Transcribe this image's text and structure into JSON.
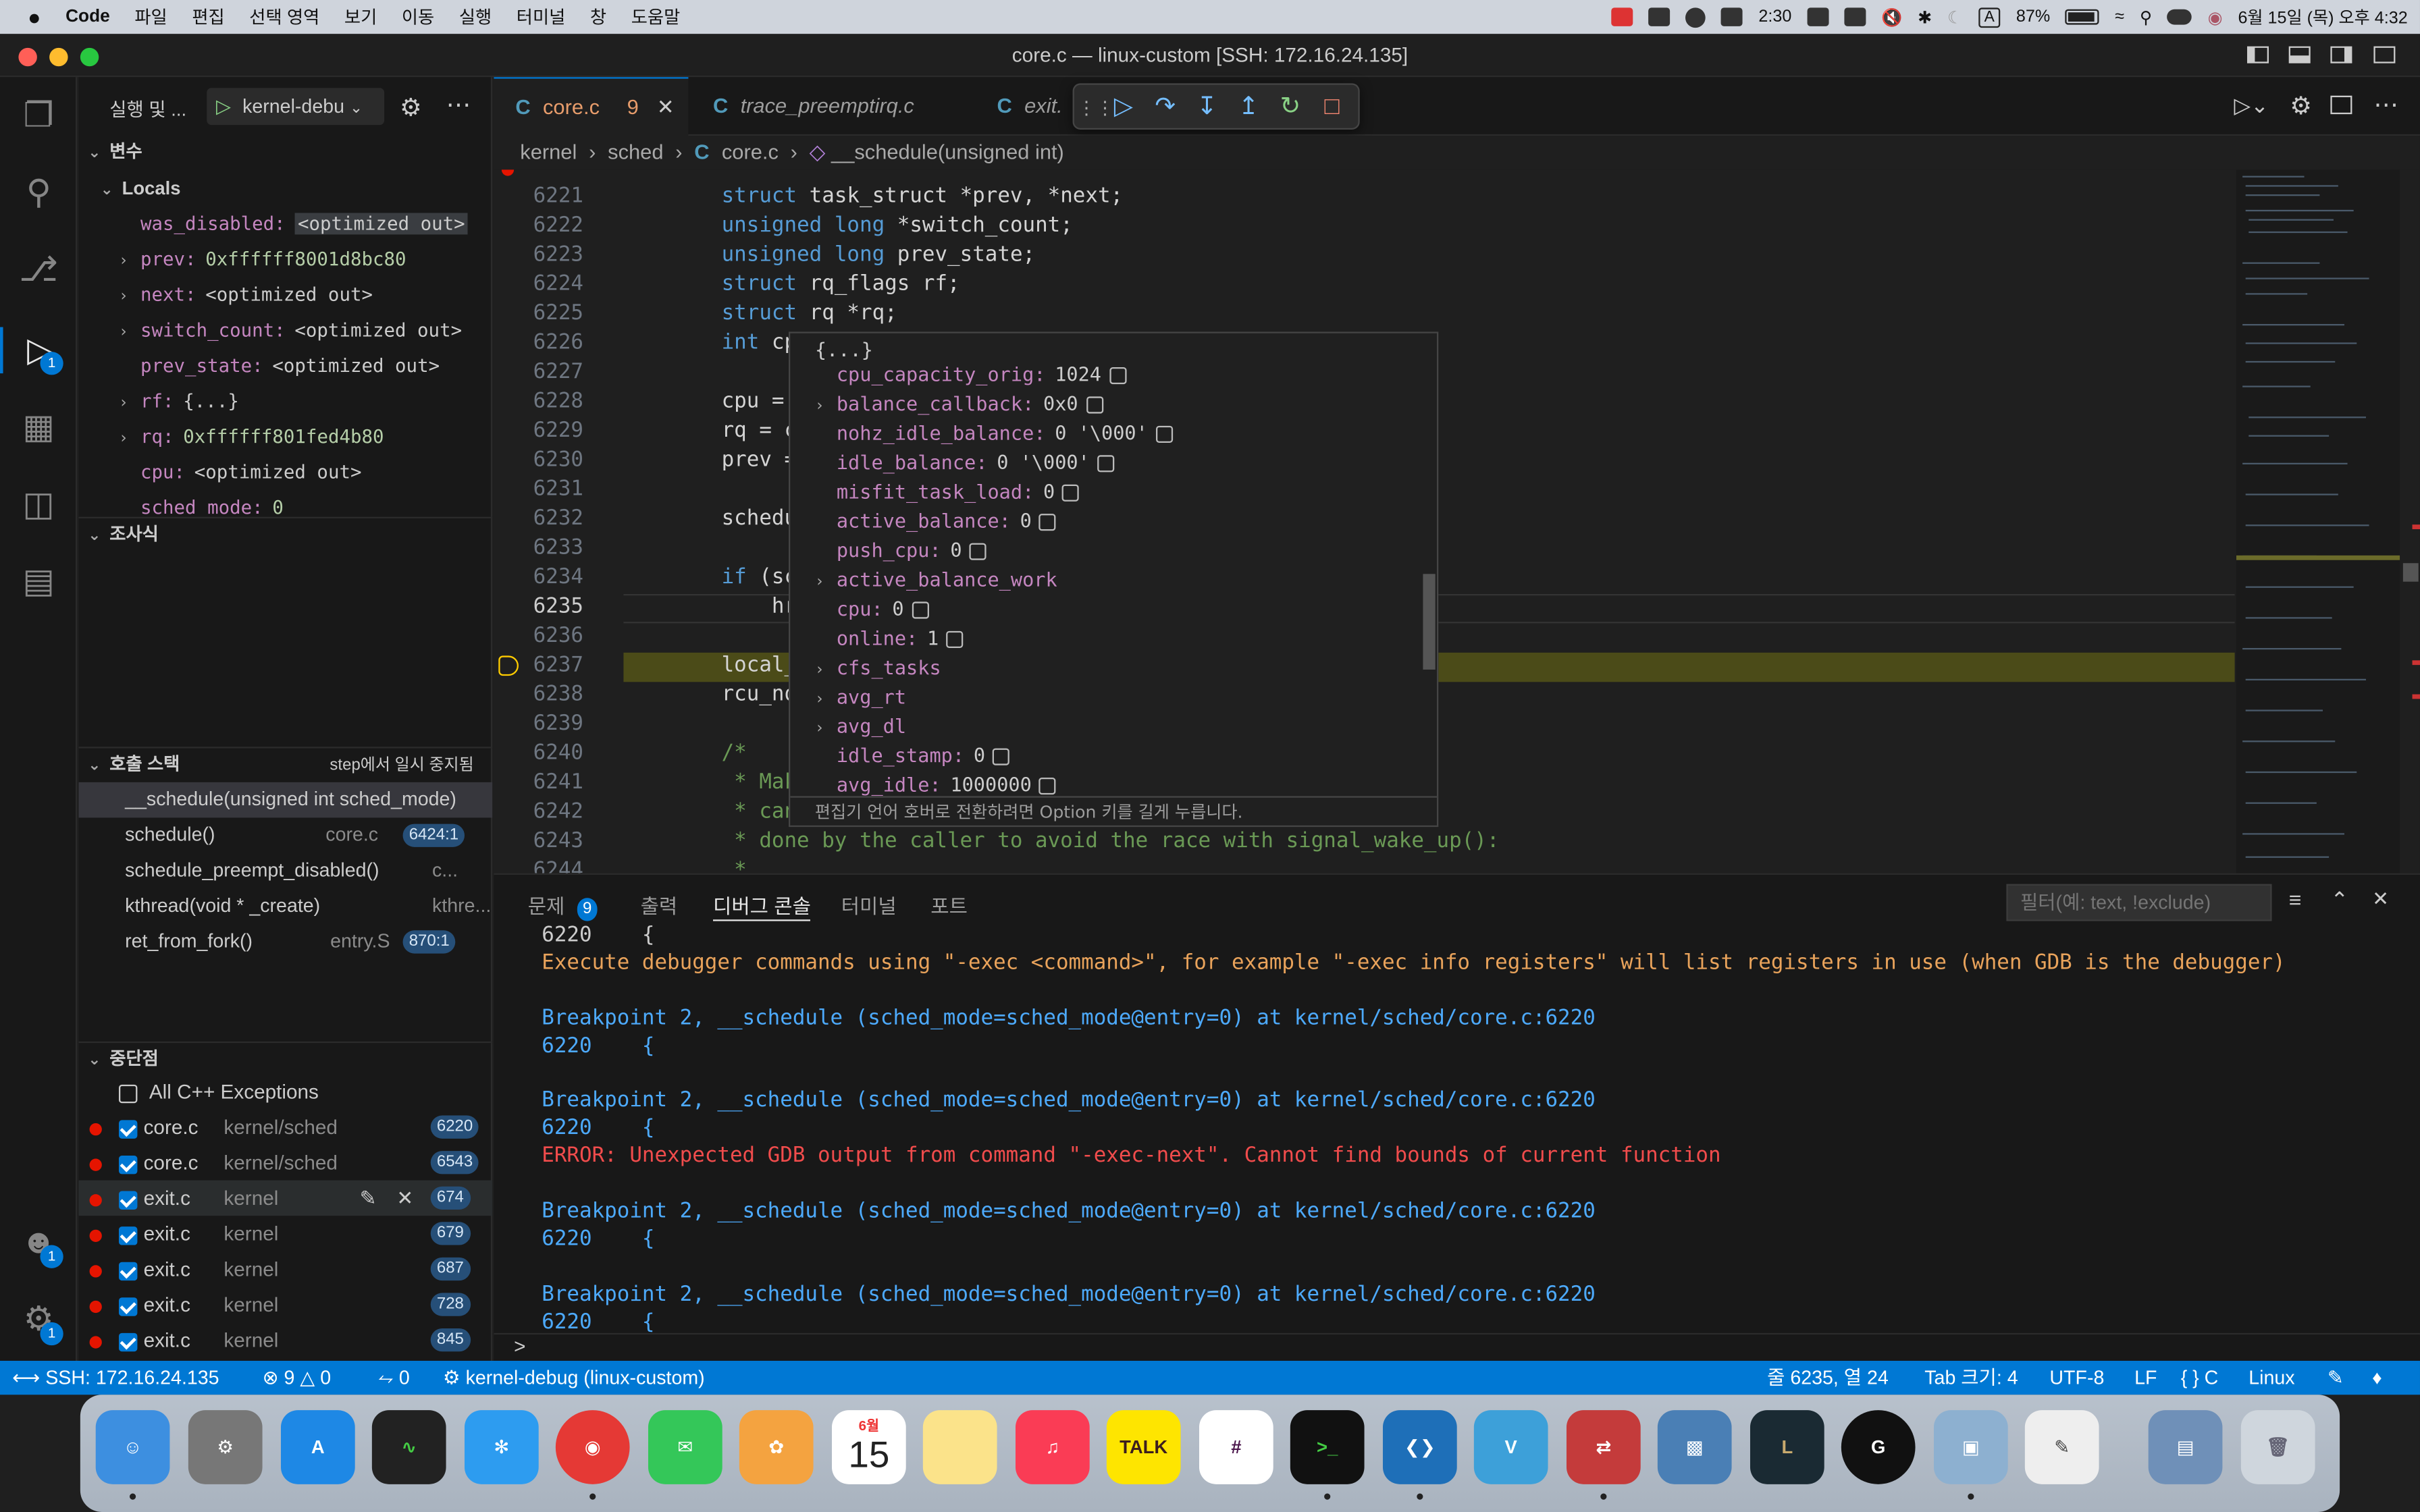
{
  "menubar": {
    "apple": "",
    "app": "Code",
    "items": [
      "파일",
      "편집",
      "선택 영역",
      "보기",
      "이동",
      "실행",
      "터미널",
      "창",
      "도움말"
    ],
    "time": "2:30",
    "battery": "87%",
    "datetime": "6월 15일 (목) 오후 4:32",
    "input_mode": "A"
  },
  "window": {
    "title": "core.c — linux-custom [SSH: 172.16.24.135]"
  },
  "activity": {
    "run_badge": "1",
    "account_badge": "1",
    "settings_badge": "1"
  },
  "sidebar": {
    "run_title": "실행 및 ...",
    "config": "kernel-debu",
    "variables_title": "변수",
    "locals_title": "Locals",
    "locals": [
      {
        "name": "was_disabled:",
        "value": "<optimized out>",
        "expandable": false
      },
      {
        "name": "prev:",
        "value": "0xffffff8001d8bc80",
        "expandable": true
      },
      {
        "name": "next:",
        "value": "<optimized out>",
        "expandable": true
      },
      {
        "name": "switch_count:",
        "value": "<optimized out>",
        "expandable": true
      },
      {
        "name": "prev_state:",
        "value": "<optimized out>",
        "expandable": false
      },
      {
        "name": "rf:",
        "value": "{...}",
        "expandable": true
      },
      {
        "name": "rq:",
        "value": "0xffffff801fed4b80",
        "expandable": true
      },
      {
        "name": "cpu:",
        "value": "<optimized out>",
        "expandable": false
      },
      {
        "name": "sched_mode:",
        "value": "0",
        "expandable": false
      }
    ],
    "watch_title": "조사식",
    "callstack_title": "호출 스택",
    "callstack_status": "step에서 일시 중지됨",
    "callstack": [
      {
        "fn": "__schedule(unsigned int sched_mode)",
        "file": "",
        "line": ""
      },
      {
        "fn": "schedule()",
        "file": "core.c",
        "line": "6424:1"
      },
      {
        "fn": "schedule_preempt_disabled()",
        "file": "c...",
        "line": ""
      },
      {
        "fn": "kthread(void * _create)",
        "file": "kthre...",
        "line": ""
      },
      {
        "fn": "ret_from_fork()",
        "file": "entry.S",
        "line": "870:1"
      }
    ],
    "breakpoints_title": "중단점",
    "all_exceptions": "All C++ Exceptions",
    "breakpoints": [
      {
        "file": "core.c",
        "path": "kernel/sched",
        "line": "6220"
      },
      {
        "file": "core.c",
        "path": "kernel/sched",
        "line": "6543"
      },
      {
        "file": "exit.c",
        "path": "kernel",
        "line": "674"
      },
      {
        "file": "exit.c",
        "path": "kernel",
        "line": "679"
      },
      {
        "file": "exit.c",
        "path": "kernel",
        "line": "687"
      },
      {
        "file": "exit.c",
        "path": "kernel",
        "line": "728"
      },
      {
        "file": "exit.c",
        "path": "kernel",
        "line": "845"
      }
    ]
  },
  "tabs": [
    {
      "label": "core.c",
      "count": "9"
    },
    {
      "label": "trace_preemptirq.c"
    },
    {
      "label": "exit."
    }
  ],
  "breadcrumb": [
    "kernel",
    "sched",
    "core.c",
    "__schedule(unsigned int)"
  ],
  "editor": {
    "lines": [
      {
        "n": "6221",
        "t": "    struct task_struct *prev, *next;"
      },
      {
        "n": "6222",
        "t": "    unsigned long *switch_count;"
      },
      {
        "n": "6223",
        "t": "    unsigned long prev_state;"
      },
      {
        "n": "6224",
        "t": "    struct rq_flags rf;"
      },
      {
        "n": "6225",
        "t": "    struct rq *rq;"
      },
      {
        "n": "6226",
        "t": "    int cpu;"
      },
      {
        "n": "6227",
        "t": ""
      },
      {
        "n": "6228",
        "t": "    cpu = smp_"
      },
      {
        "n": "6229",
        "t": "    rq = cpu_r"
      },
      {
        "n": "6230",
        "t": "    prev = rq-"
      },
      {
        "n": "6231",
        "t": ""
      },
      {
        "n": "6232",
        "t": "    schedule_d"
      },
      {
        "n": "6233",
        "t": ""
      },
      {
        "n": "6234",
        "t": "    if (sched_"
      },
      {
        "n": "6235",
        "t": "        hrtick"
      },
      {
        "n": "6236",
        "t": ""
      },
      {
        "n": "6237",
        "t": "    local_irq_"
      },
      {
        "n": "6238",
        "t": "    rcu_note_c"
      },
      {
        "n": "6239",
        "t": ""
      },
      {
        "n": "6240",
        "t": "    /*"
      },
      {
        "n": "6241",
        "t": "     * Make su"
      },
      {
        "n": "6242",
        "t": "     * can't b"
      },
      {
        "n": "6243",
        "t": "     * done by the caller to avoid the race with signal_wake_up():"
      },
      {
        "n": "6244",
        "t": "     *"
      }
    ],
    "top_partial": "6220"
  },
  "hover": {
    "header": "{...}",
    "rows": [
      {
        "k": "cpu_capacity_orig:",
        "v": "1024",
        "exp": false,
        "bin": true
      },
      {
        "k": "balance_callback:",
        "v": "0x0",
        "exp": true,
        "bin": true
      },
      {
        "k": "nohz_idle_balance:",
        "v": "0 '\\000'",
        "exp": false,
        "bin": true
      },
      {
        "k": "idle_balance:",
        "v": "0 '\\000'",
        "exp": false,
        "bin": true
      },
      {
        "k": "misfit_task_load:",
        "v": "0",
        "exp": false,
        "bin": true
      },
      {
        "k": "active_balance:",
        "v": "0",
        "exp": false,
        "bin": true
      },
      {
        "k": "push_cpu:",
        "v": "0",
        "exp": false,
        "bin": true
      },
      {
        "k": "active_balance_work",
        "v": "",
        "exp": true,
        "bin": false
      },
      {
        "k": "cpu:",
        "v": "0",
        "exp": false,
        "bin": true
      },
      {
        "k": "online:",
        "v": "1",
        "exp": false,
        "bin": true
      },
      {
        "k": "cfs_tasks",
        "v": "",
        "exp": true,
        "bin": false
      },
      {
        "k": "avg_rt",
        "v": "",
        "exp": true,
        "bin": false
      },
      {
        "k": "avg_dl",
        "v": "",
        "exp": true,
        "bin": false
      },
      {
        "k": "idle_stamp:",
        "v": "0",
        "exp": false,
        "bin": true
      },
      {
        "k": "avg_idle:",
        "v": "1000000",
        "exp": false,
        "bin": true
      }
    ],
    "footer": "편집기 언어 호버로 전환하려면 Option 키를 길게 누릅니다."
  },
  "panel": {
    "tabs": [
      "문제",
      "출력",
      "디버그 콘솔",
      "터미널",
      "포트"
    ],
    "problems_count": "9",
    "filter_placeholder": "필터(예: text, !exclude)",
    "lines": [
      {
        "c": "white",
        "t": "6220\t{"
      },
      {
        "c": "orange",
        "t": "Execute debugger commands using \"-exec <command>\", for example \"-exec info registers\" will list registers in use (when GDB is the debugger)"
      },
      {
        "c": "white",
        "t": ""
      },
      {
        "c": "blue",
        "t": "Breakpoint 2, __schedule (sched_mode=sched_mode@entry=0) at kernel/sched/core.c:6220"
      },
      {
        "c": "blue",
        "t": "6220\t{"
      },
      {
        "c": "white",
        "t": ""
      },
      {
        "c": "blue",
        "t": "Breakpoint 2, __schedule (sched_mode=sched_mode@entry=0) at kernel/sched/core.c:6220"
      },
      {
        "c": "blue",
        "t": "6220\t{"
      },
      {
        "c": "err",
        "t": "ERROR: Unexpected GDB output from command \"-exec-next\". Cannot find bounds of current function"
      },
      {
        "c": "white",
        "t": ""
      },
      {
        "c": "blue",
        "t": "Breakpoint 2, __schedule (sched_mode=sched_mode@entry=0) at kernel/sched/core.c:6220"
      },
      {
        "c": "blue",
        "t": "6220\t{"
      },
      {
        "c": "white",
        "t": ""
      },
      {
        "c": "blue",
        "t": "Breakpoint 2, __schedule (sched_mode=sched_mode@entry=0) at kernel/sched/core.c:6220"
      },
      {
        "c": "blue",
        "t": "6220\t{"
      }
    ],
    "prompt": ">"
  },
  "status": {
    "remote": "SSH: 172.16.24.135",
    "errors": "9",
    "warnings": "0",
    "ports": "0",
    "debug": "kernel-debug (linux-custom)",
    "position": "줄 6235, 열 24",
    "tab": "Tab 크기: 4",
    "encoding": "UTF-8",
    "eol": "LF",
    "lang": "C",
    "os": "Linux"
  },
  "dock": {
    "calendar_month": "6월",
    "calendar_day": "15",
    "talk": "TALK"
  }
}
